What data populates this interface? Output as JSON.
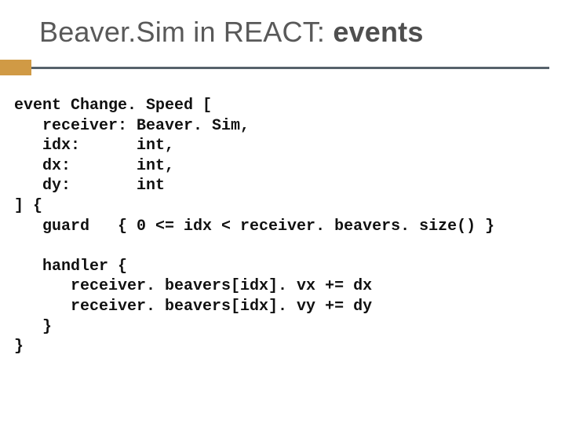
{
  "title": {
    "part1": "Beaver.Sim in REACT: ",
    "part2_bold": "events"
  },
  "code": {
    "l1": "event Change. Speed [",
    "l2": "   receiver: Beaver. Sim,",
    "l3": "   idx:      int,",
    "l4": "   dx:       int,",
    "l5": "   dy:       int",
    "l6": "] {",
    "l7": "   guard   { 0 <= idx < receiver. beavers. size() }",
    "l8": "",
    "l9": "   handler {",
    "l10": "      receiver. beavers[idx]. vx += dx",
    "l11": "      receiver. beavers[idx]. vy += dy",
    "l12": "   }",
    "l13": "}"
  }
}
